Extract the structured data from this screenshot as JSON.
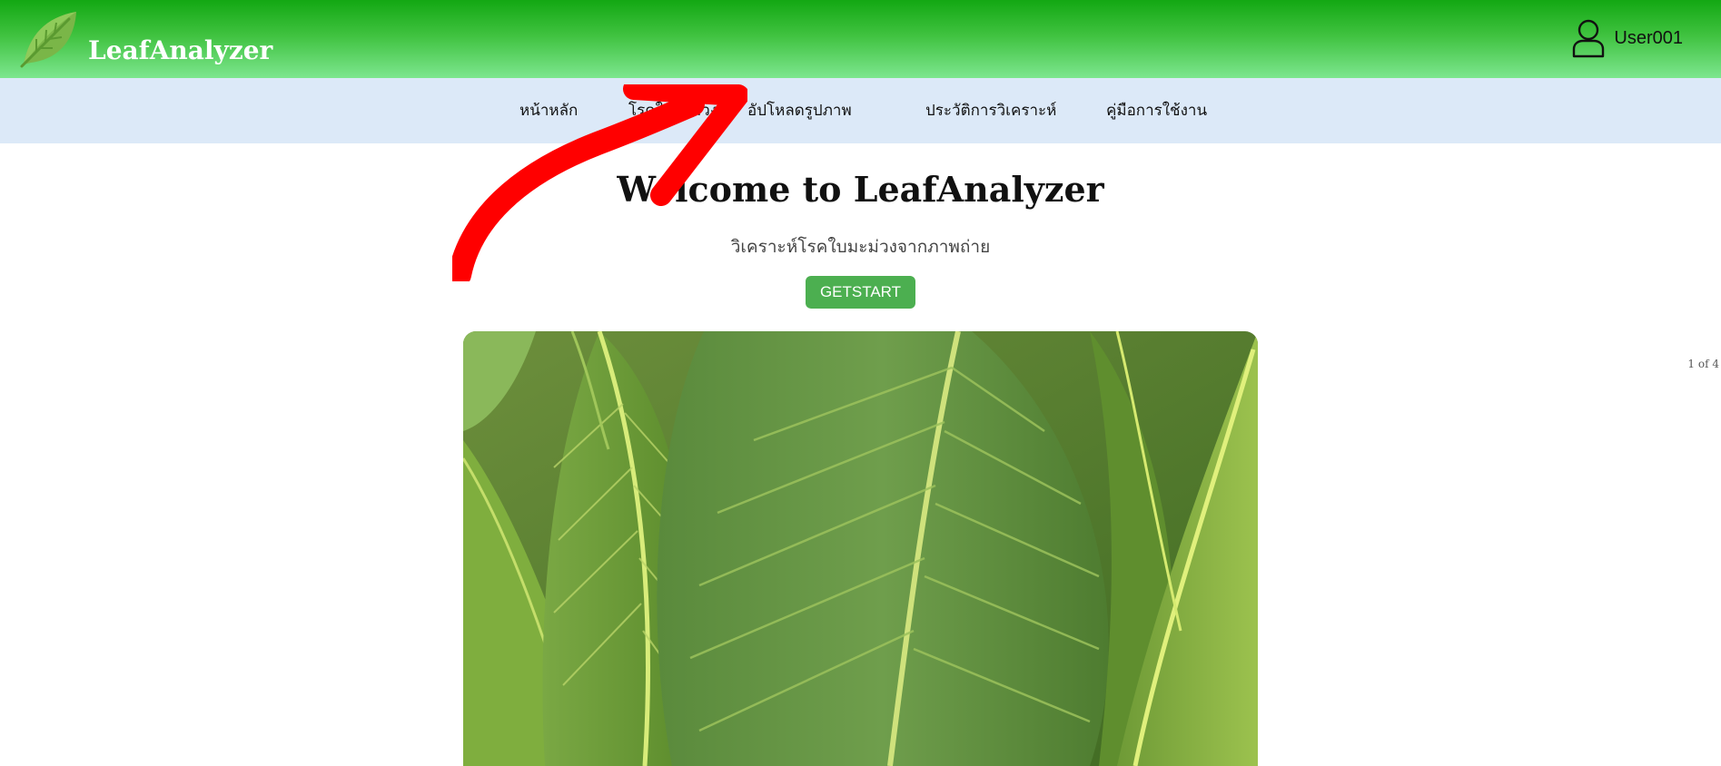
{
  "header": {
    "brand": "LeafAnalyzer",
    "user_name": "User001",
    "logo_icon": "leaf-logo-icon",
    "user_icon": "user-icon",
    "gradient_top": "#13a813",
    "gradient_bottom": "#7de68f"
  },
  "nav": {
    "items": [
      {
        "label": "หน้าหลัก"
      },
      {
        "label": "โรคใบมะม่วง"
      },
      {
        "label": "อัปโหลดรูปภาพ"
      },
      {
        "label": "ประวัติการวิเคราะห์"
      },
      {
        "label": "คู่มือการใช้งาน"
      }
    ],
    "background": "#dce9f8"
  },
  "main": {
    "title": "Welcome to LeafAnalyzer",
    "subtitle": "วิเคราะห์โรคใบมะม่วงจากภาพถ่าย",
    "cta_label": "GETSTART",
    "cta_color": "#4caf50"
  },
  "slideshow": {
    "counter": "1 of 4",
    "image_subject": "close-up of green mango leaves"
  },
  "annotation": {
    "type": "red-arrow",
    "color": "#ff0000",
    "points_to": "อัปโหลดรูปภาพ"
  }
}
